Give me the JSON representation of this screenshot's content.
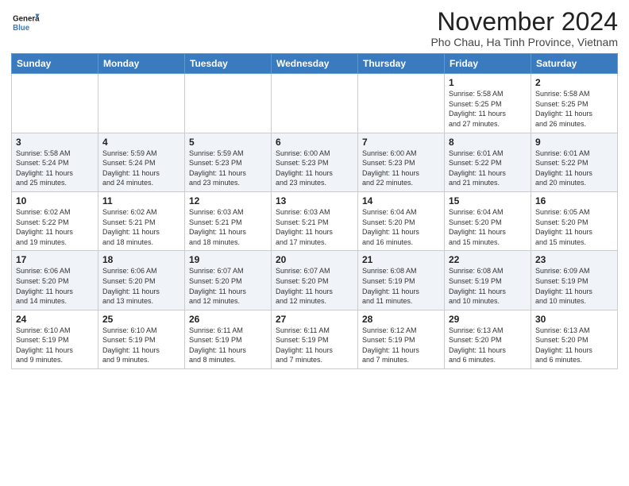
{
  "logo": {
    "line1": "General",
    "line2": "Blue"
  },
  "title": "November 2024",
  "subtitle": "Pho Chau, Ha Tinh Province, Vietnam",
  "header": {
    "accent_color": "#3a7abf"
  },
  "weekdays": [
    "Sunday",
    "Monday",
    "Tuesday",
    "Wednesday",
    "Thursday",
    "Friday",
    "Saturday"
  ],
  "weeks": [
    [
      {
        "day": "",
        "info": ""
      },
      {
        "day": "",
        "info": ""
      },
      {
        "day": "",
        "info": ""
      },
      {
        "day": "",
        "info": ""
      },
      {
        "day": "",
        "info": ""
      },
      {
        "day": "1",
        "info": "Sunrise: 5:58 AM\nSunset: 5:25 PM\nDaylight: 11 hours\nand 27 minutes."
      },
      {
        "day": "2",
        "info": "Sunrise: 5:58 AM\nSunset: 5:25 PM\nDaylight: 11 hours\nand 26 minutes."
      }
    ],
    [
      {
        "day": "3",
        "info": "Sunrise: 5:58 AM\nSunset: 5:24 PM\nDaylight: 11 hours\nand 25 minutes."
      },
      {
        "day": "4",
        "info": "Sunrise: 5:59 AM\nSunset: 5:24 PM\nDaylight: 11 hours\nand 24 minutes."
      },
      {
        "day": "5",
        "info": "Sunrise: 5:59 AM\nSunset: 5:23 PM\nDaylight: 11 hours\nand 23 minutes."
      },
      {
        "day": "6",
        "info": "Sunrise: 6:00 AM\nSunset: 5:23 PM\nDaylight: 11 hours\nand 23 minutes."
      },
      {
        "day": "7",
        "info": "Sunrise: 6:00 AM\nSunset: 5:23 PM\nDaylight: 11 hours\nand 22 minutes."
      },
      {
        "day": "8",
        "info": "Sunrise: 6:01 AM\nSunset: 5:22 PM\nDaylight: 11 hours\nand 21 minutes."
      },
      {
        "day": "9",
        "info": "Sunrise: 6:01 AM\nSunset: 5:22 PM\nDaylight: 11 hours\nand 20 minutes."
      }
    ],
    [
      {
        "day": "10",
        "info": "Sunrise: 6:02 AM\nSunset: 5:22 PM\nDaylight: 11 hours\nand 19 minutes."
      },
      {
        "day": "11",
        "info": "Sunrise: 6:02 AM\nSunset: 5:21 PM\nDaylight: 11 hours\nand 18 minutes."
      },
      {
        "day": "12",
        "info": "Sunrise: 6:03 AM\nSunset: 5:21 PM\nDaylight: 11 hours\nand 18 minutes."
      },
      {
        "day": "13",
        "info": "Sunrise: 6:03 AM\nSunset: 5:21 PM\nDaylight: 11 hours\nand 17 minutes."
      },
      {
        "day": "14",
        "info": "Sunrise: 6:04 AM\nSunset: 5:20 PM\nDaylight: 11 hours\nand 16 minutes."
      },
      {
        "day": "15",
        "info": "Sunrise: 6:04 AM\nSunset: 5:20 PM\nDaylight: 11 hours\nand 15 minutes."
      },
      {
        "day": "16",
        "info": "Sunrise: 6:05 AM\nSunset: 5:20 PM\nDaylight: 11 hours\nand 15 minutes."
      }
    ],
    [
      {
        "day": "17",
        "info": "Sunrise: 6:06 AM\nSunset: 5:20 PM\nDaylight: 11 hours\nand 14 minutes."
      },
      {
        "day": "18",
        "info": "Sunrise: 6:06 AM\nSunset: 5:20 PM\nDaylight: 11 hours\nand 13 minutes."
      },
      {
        "day": "19",
        "info": "Sunrise: 6:07 AM\nSunset: 5:20 PM\nDaylight: 11 hours\nand 12 minutes."
      },
      {
        "day": "20",
        "info": "Sunrise: 6:07 AM\nSunset: 5:20 PM\nDaylight: 11 hours\nand 12 minutes."
      },
      {
        "day": "21",
        "info": "Sunrise: 6:08 AM\nSunset: 5:19 PM\nDaylight: 11 hours\nand 11 minutes."
      },
      {
        "day": "22",
        "info": "Sunrise: 6:08 AM\nSunset: 5:19 PM\nDaylight: 11 hours\nand 10 minutes."
      },
      {
        "day": "23",
        "info": "Sunrise: 6:09 AM\nSunset: 5:19 PM\nDaylight: 11 hours\nand 10 minutes."
      }
    ],
    [
      {
        "day": "24",
        "info": "Sunrise: 6:10 AM\nSunset: 5:19 PM\nDaylight: 11 hours\nand 9 minutes."
      },
      {
        "day": "25",
        "info": "Sunrise: 6:10 AM\nSunset: 5:19 PM\nDaylight: 11 hours\nand 9 minutes."
      },
      {
        "day": "26",
        "info": "Sunrise: 6:11 AM\nSunset: 5:19 PM\nDaylight: 11 hours\nand 8 minutes."
      },
      {
        "day": "27",
        "info": "Sunrise: 6:11 AM\nSunset: 5:19 PM\nDaylight: 11 hours\nand 7 minutes."
      },
      {
        "day": "28",
        "info": "Sunrise: 6:12 AM\nSunset: 5:19 PM\nDaylight: 11 hours\nand 7 minutes."
      },
      {
        "day": "29",
        "info": "Sunrise: 6:13 AM\nSunset: 5:20 PM\nDaylight: 11 hours\nand 6 minutes."
      },
      {
        "day": "30",
        "info": "Sunrise: 6:13 AM\nSunset: 5:20 PM\nDaylight: 11 hours\nand 6 minutes."
      }
    ]
  ]
}
